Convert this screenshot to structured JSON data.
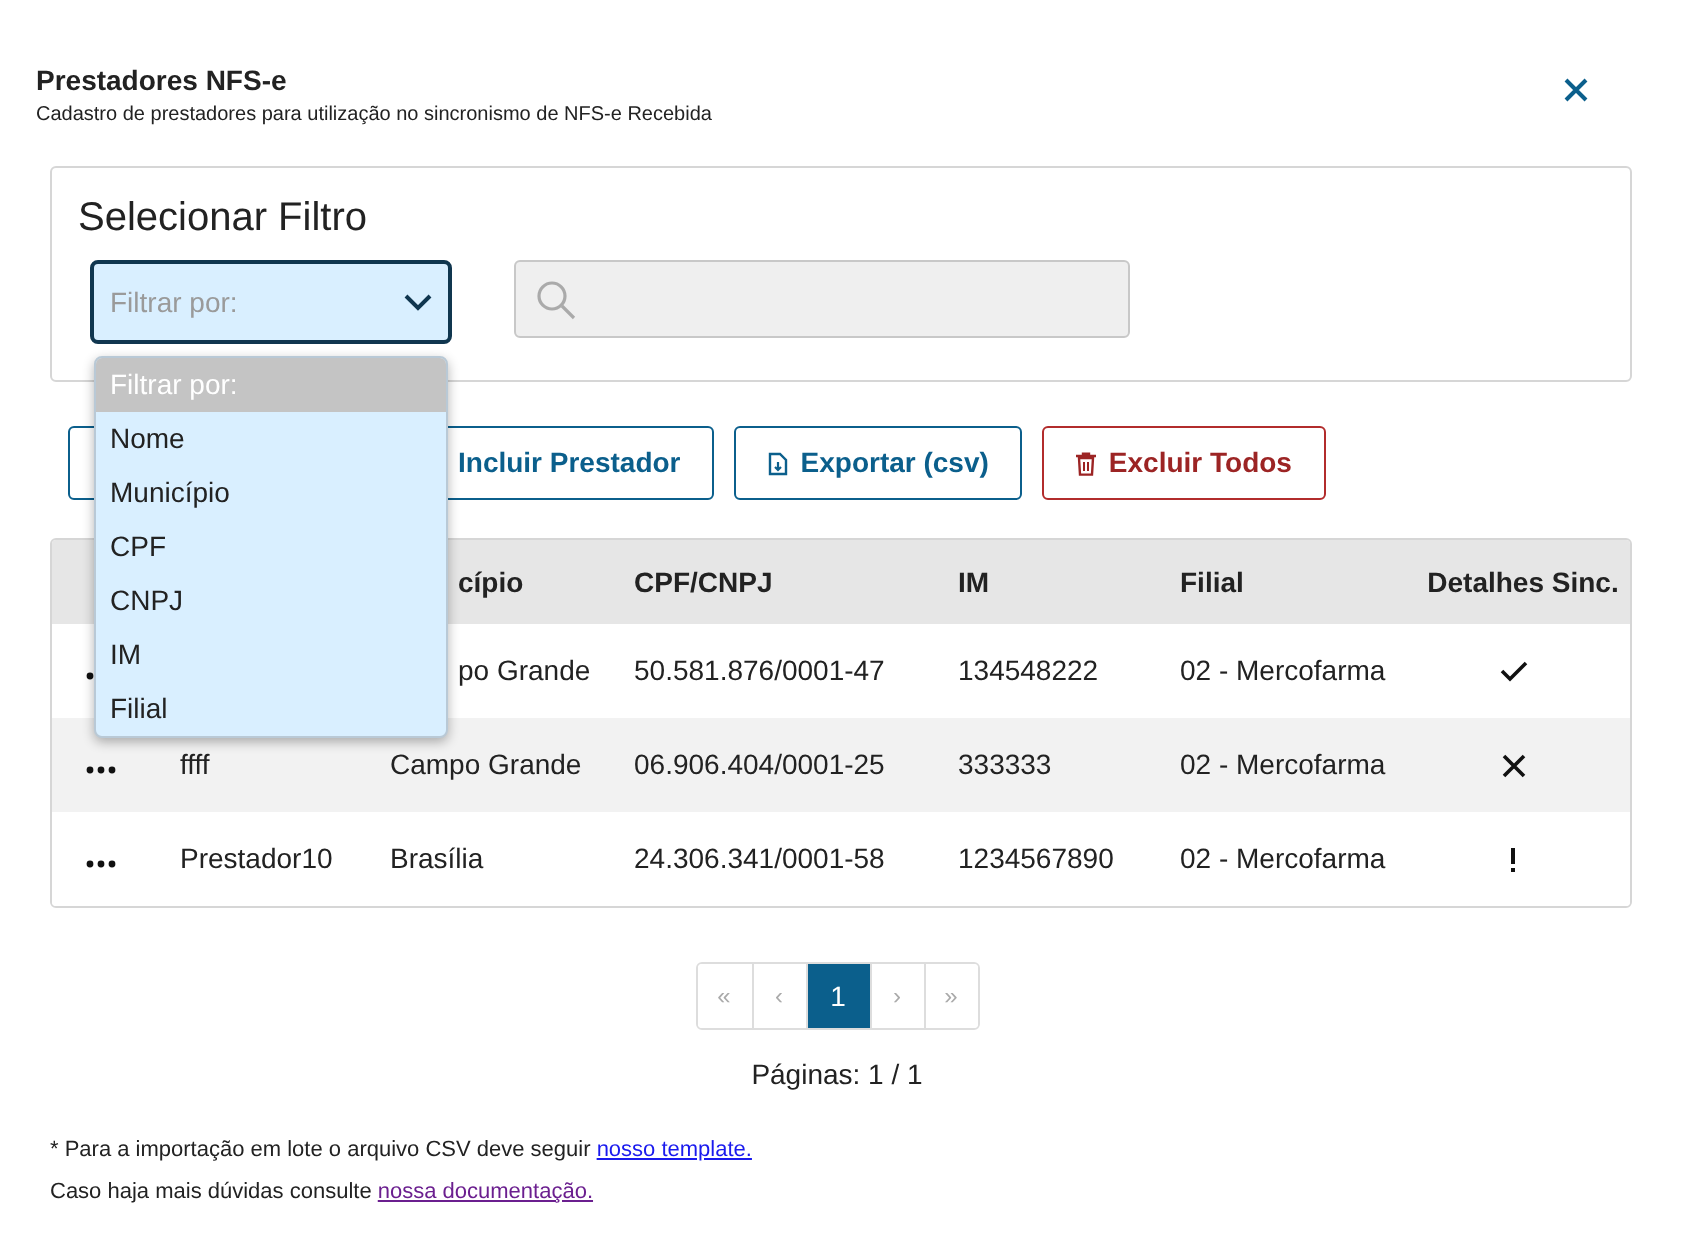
{
  "header": {
    "title": "Prestadores NFS-e",
    "subtitle": "Cadastro de prestadores para utilização no sincronismo de NFS-e Recebida"
  },
  "filter": {
    "title": "Selecionar Filtro",
    "select": {
      "placeholder": "Filtrar por:",
      "expanded": true
    },
    "options": [
      {
        "label": "Filtrar por:",
        "selected": true
      },
      {
        "label": "Nome",
        "selected": false
      },
      {
        "label": "Município",
        "selected": false
      },
      {
        "label": "CPF",
        "selected": false
      },
      {
        "label": "CNPJ",
        "selected": false
      },
      {
        "label": "IM",
        "selected": false
      },
      {
        "label": "Filial",
        "selected": false
      }
    ]
  },
  "actions": [
    {
      "kind": "hidden"
    },
    {
      "label": "Incluir Prestador",
      "kind": "plain"
    },
    {
      "label": "Exportar (csv)",
      "kind": "export"
    },
    {
      "label": "Excluir Todos",
      "kind": "delete"
    }
  ],
  "table": {
    "columns": [
      "",
      "cípio",
      "CPF/CNPJ",
      "IM",
      "Filial",
      "Detalhes Sinc."
    ],
    "rows": [
      {
        "name": "",
        "municipio": "po Grande",
        "doc": "50.581.876/0001-47",
        "im": "134548222",
        "filial": "02 - Mercofarma",
        "kind": "ok"
      },
      {
        "name": "ffff",
        "municipio": "Campo Grande",
        "doc": "06.906.404/0001-25",
        "im": "333333",
        "filial": "02 - Mercofarma",
        "kind": "error"
      },
      {
        "name": "Prestador10",
        "municipio": "Brasília",
        "doc": "24.306.341/0001-58",
        "im": "1234567890",
        "filial": "02 - Mercofarma",
        "kind": "warning"
      }
    ]
  },
  "pagination": {
    "pages": [
      {
        "label": "«",
        "selected": false
      },
      {
        "label": "‹",
        "selected": false
      },
      {
        "label": "1",
        "selected": true
      },
      {
        "label": "›",
        "selected": false
      },
      {
        "label": "»",
        "selected": false
      }
    ],
    "summary": "Páginas: 1 / 1"
  },
  "notes": [
    {
      "text": "* Para a importação em lote o arquivo CSV deve seguir",
      "link": "nosso template."
    },
    {
      "text": "Caso haja mais dúvidas consulte",
      "link": "nossa documentação."
    }
  ]
}
